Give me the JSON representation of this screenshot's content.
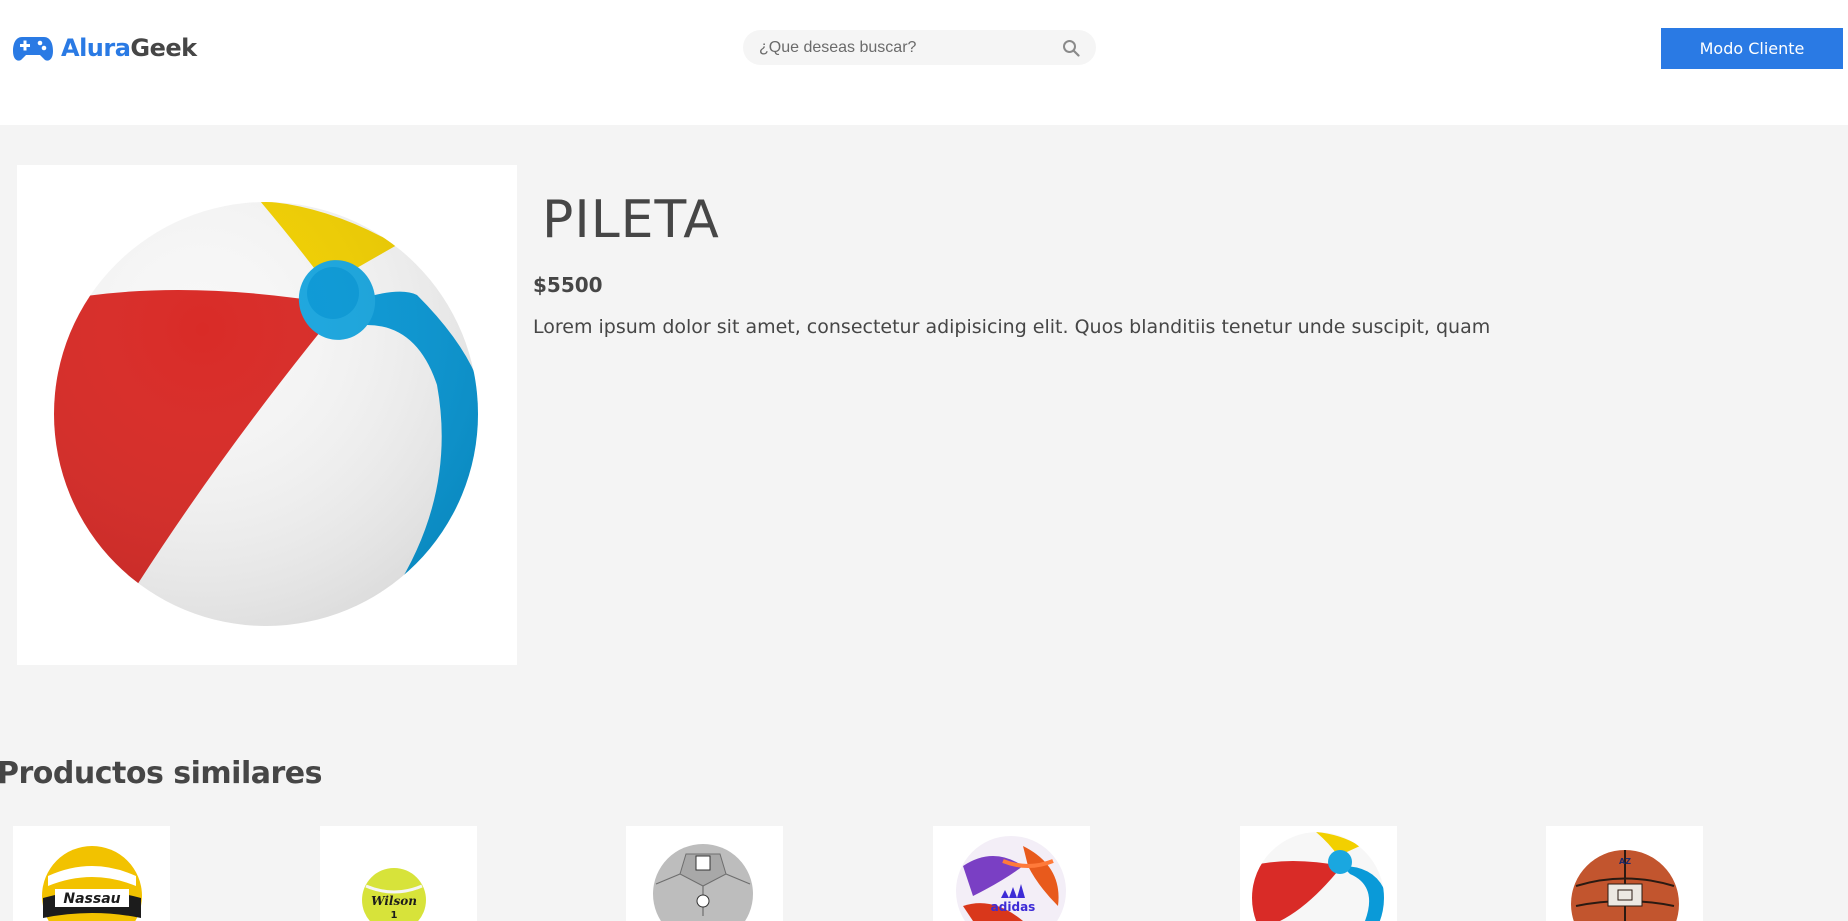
{
  "brand": {
    "part1": "Alura",
    "part2": "Geek"
  },
  "search": {
    "placeholder": "¿Que deseas buscar?"
  },
  "header": {
    "cta_label": "Modo Cliente"
  },
  "product": {
    "title": "PILETA",
    "price": "$5500",
    "description": "Lorem ipsum dolor sit amet, consectetur adipisicing elit. Quos blanditiis tenetur unde suscipit, quam"
  },
  "similar": {
    "title": "Productos similares",
    "cards": [
      {
        "product": "volleyball-nassau",
        "logo_text": "Nassau"
      },
      {
        "product": "tennis-ball-wilson",
        "logo_text": "Wilson"
      },
      {
        "product": "soccer-ball-grey"
      },
      {
        "product": "soccer-ball-adidas",
        "logo_text": "adidas"
      },
      {
        "product": "beach-ball"
      },
      {
        "product": "basketball"
      }
    ]
  },
  "colors": {
    "accent": "#2a7ae4",
    "text": "#464646",
    "background": "#f4f4f4"
  }
}
